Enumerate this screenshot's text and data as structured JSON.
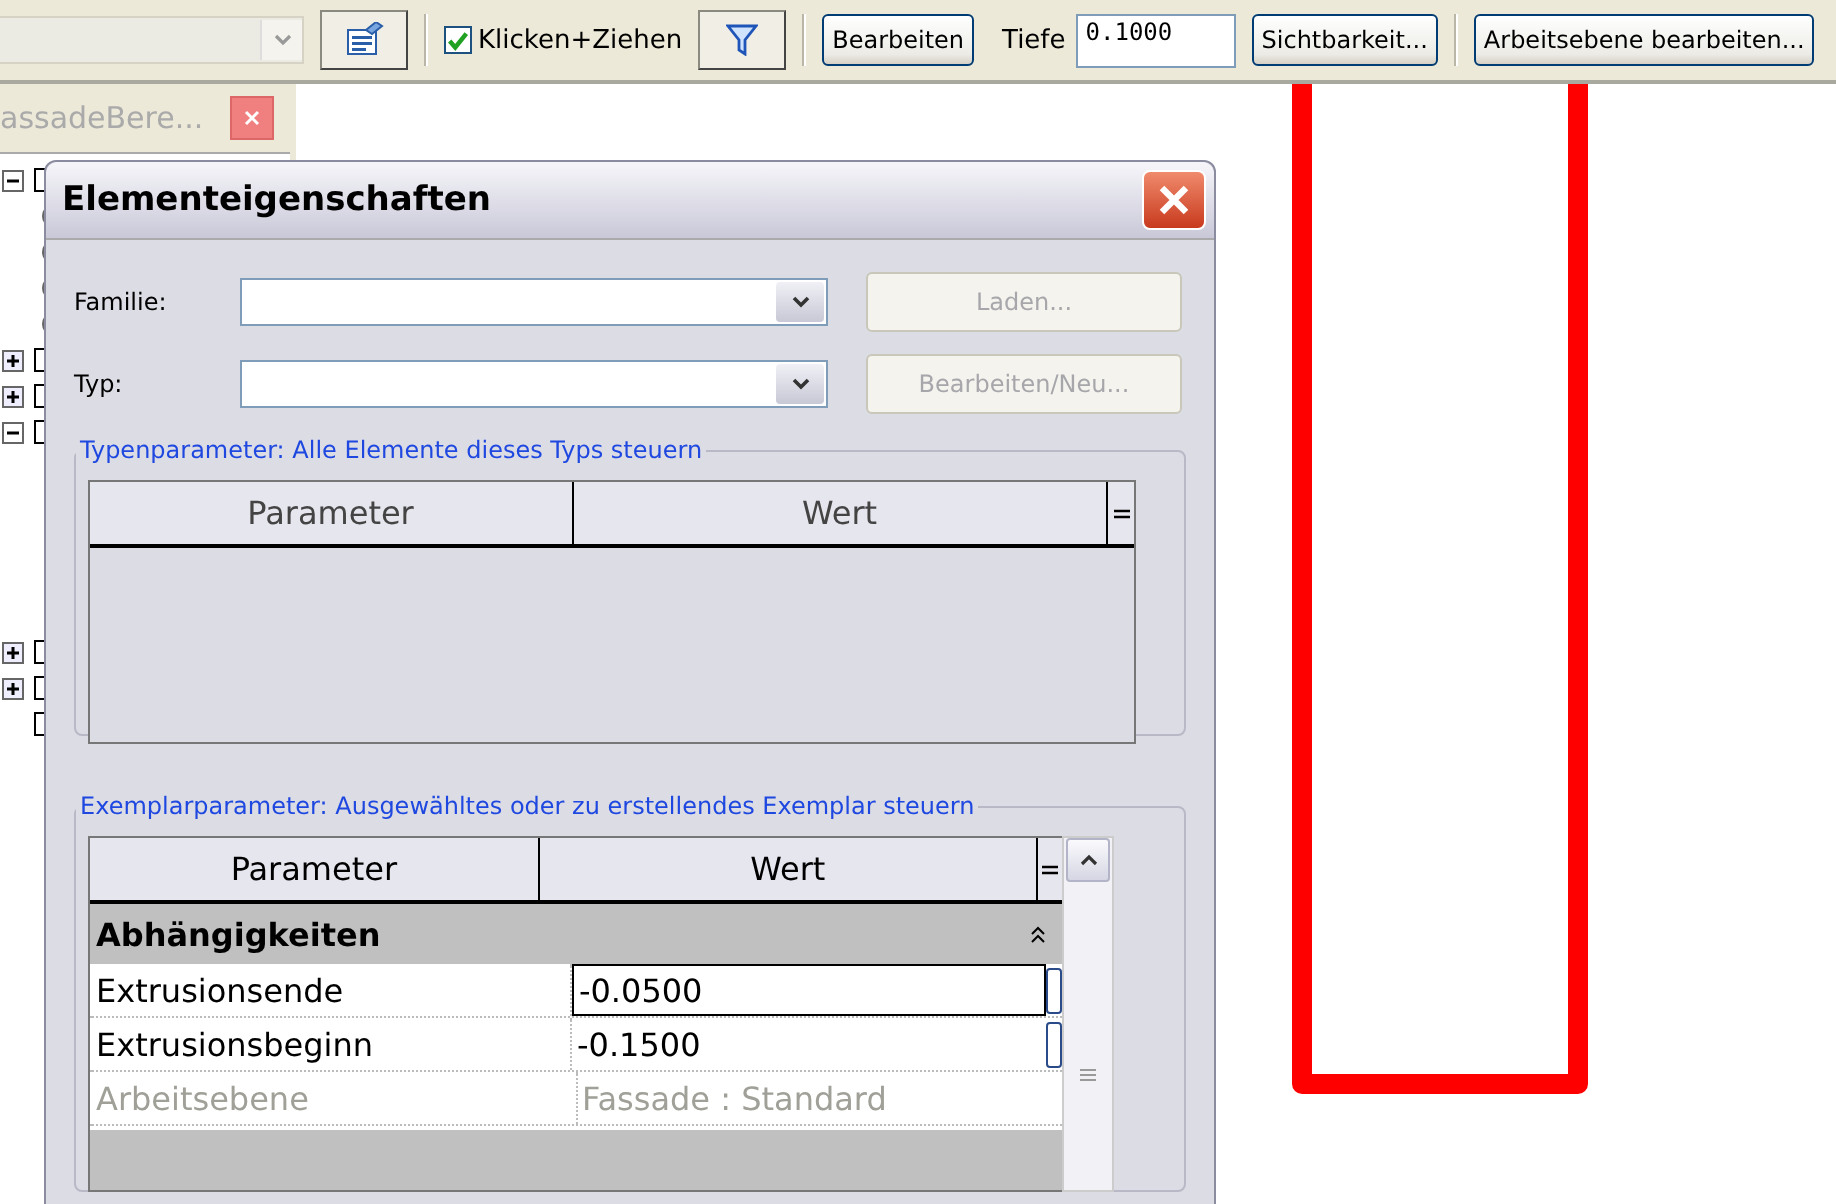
{
  "toolbar": {
    "checkbox": {
      "label": "Klicken+Ziehen",
      "checked": true
    },
    "buttons": [
      {
        "label": "Bearbeiten"
      }
    ],
    "depth": {
      "label": "Tiefe",
      "value": "0.1000"
    },
    "more_buttons": [
      {
        "label": "Sichtbarkeit..."
      },
      {
        "label": "Arbeitsebene bearbeiten..."
      }
    ]
  },
  "browser": {
    "tab_title": "assadeBere...",
    "tree_nodes": [
      {
        "expanded": true
      },
      {
        "expanded": false
      },
      {
        "expanded": false
      },
      {
        "expanded": true
      },
      {
        "expanded": false
      },
      {
        "expanded": false
      },
      {
        "leaf": true
      }
    ]
  },
  "dialog": {
    "title": "Elementeigenschaften",
    "fields": [
      {
        "label": "Familie:",
        "button": "Laden...",
        "button_disabled": true
      },
      {
        "label": "Typ:",
        "button": "Bearbeiten/Neu...",
        "button_disabled": true
      }
    ],
    "type_params": {
      "legend": "Typenparameter: Alle Elemente dieses Typs steuern",
      "columns": [
        "Parameter",
        "Wert"
      ]
    },
    "instance_params": {
      "legend": "Exemplarparameter: Ausgewähltes oder zu erstellendes Exemplar steuern",
      "columns": [
        "Parameter",
        "Wert"
      ],
      "groups": [
        {
          "name": "Abhängigkeiten",
          "expanded": true,
          "rows": [
            {
              "parameter": "Extrusionsende",
              "value": "-0.0500",
              "selected": true,
              "disabled": false
            },
            {
              "parameter": "Extrusionsbeginn",
              "value": "-0.1500",
              "selected": false,
              "disabled": false
            },
            {
              "parameter": "Arbeitsebene",
              "value": "Fassade : Standard",
              "selected": false,
              "disabled": true
            }
          ]
        }
      ]
    }
  }
}
